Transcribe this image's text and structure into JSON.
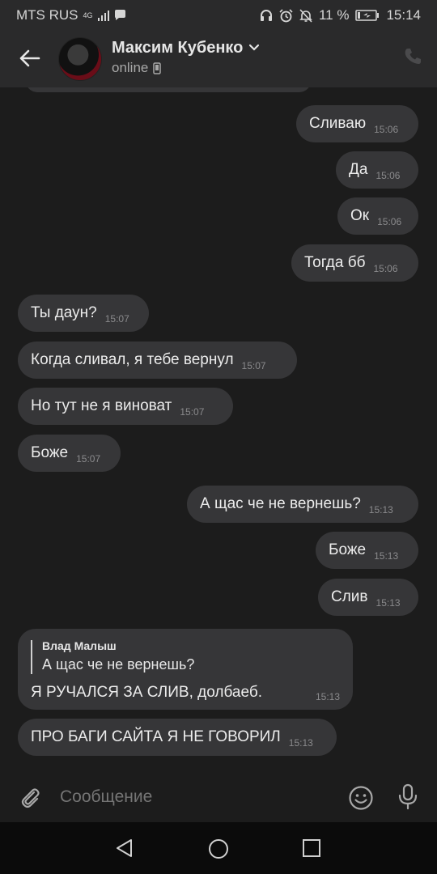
{
  "status_bar": {
    "carrier": "MTS RUS",
    "network": "4G",
    "battery": "11 %",
    "time": "15:14"
  },
  "header": {
    "contact_name": "Максим Кубенко",
    "status": "online"
  },
  "messages": [
    {
      "dir": "out",
      "text": "Сливаю",
      "time": "15:06"
    },
    {
      "dir": "out",
      "text": "Да",
      "time": "15:06"
    },
    {
      "dir": "out",
      "text": "Ок",
      "time": "15:06"
    },
    {
      "dir": "out",
      "text": "Тогда бб",
      "time": "15:06"
    },
    {
      "dir": "in",
      "text": "Ты даун?",
      "time": "15:07"
    },
    {
      "dir": "in",
      "text": "Когда сливал, я тебе вернул",
      "time": "15:07"
    },
    {
      "dir": "in",
      "text": "Но тут не я виноват",
      "time": "15:07"
    },
    {
      "dir": "in",
      "text": "Боже",
      "time": "15:07"
    },
    {
      "dir": "out",
      "text": "А щас че не вернешь?",
      "time": "15:13"
    },
    {
      "dir": "out",
      "text": "Боже",
      "time": "15:13"
    },
    {
      "dir": "out",
      "text": "Слив",
      "time": "15:13"
    }
  ],
  "reply_message": {
    "quote_author": "Влад Малыш",
    "quote_text": "А щас че не вернешь?",
    "text": "Я РУЧАЛСЯ ЗА СЛИВ, долбаеб.",
    "time": "15:13"
  },
  "last_message": {
    "text": "ПРО БАГИ САЙТА Я НЕ ГОВОРИЛ",
    "time": "15:13"
  },
  "composer": {
    "placeholder": "Сообщение"
  }
}
